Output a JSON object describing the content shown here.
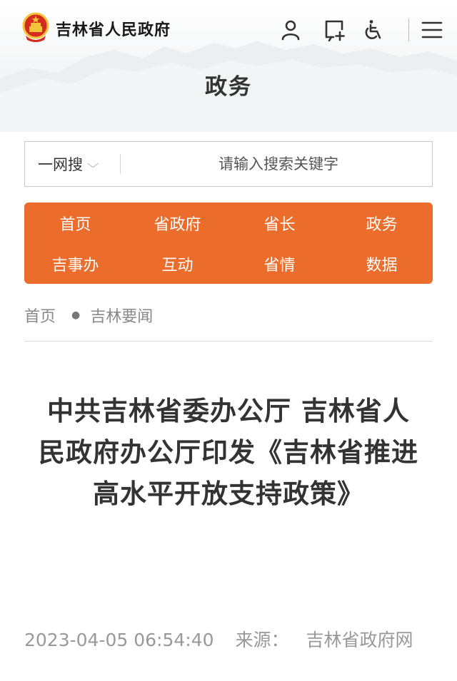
{
  "header": {
    "site_name": "吉林省人民政府",
    "icons": [
      "user-icon",
      "add-window-icon",
      "accessibility-icon",
      "menu-icon"
    ]
  },
  "page": {
    "heading": "政务"
  },
  "search": {
    "scope_label": "一网搜",
    "placeholder": "请输入搜索关键字"
  },
  "nav": {
    "items": [
      "首页",
      "省政府",
      "省长",
      "政务",
      "吉事办",
      "互动",
      "省情",
      "数据"
    ]
  },
  "breadcrumb": {
    "items": [
      "首页",
      "吉林要闻"
    ]
  },
  "article": {
    "title": "中共吉林省委办公厅 吉林省人民政府办公厅印发《吉林省推进高水平开放支持政策》",
    "datetime": "2023-04-05 06:54:40",
    "source_label": "来源：",
    "source": "吉林省政府网"
  },
  "colors": {
    "nav_background": "#ec6d2b",
    "emblem_red": "#d52a1e",
    "emblem_gold": "#f3c33a"
  }
}
